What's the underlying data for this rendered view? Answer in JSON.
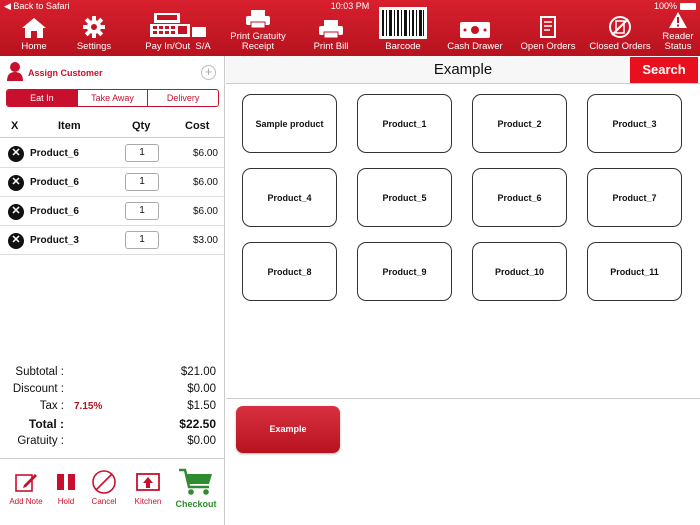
{
  "status": {
    "back": "◀ Back to Safari",
    "time": "10:03 PM",
    "battery": "100%"
  },
  "toolbar": {
    "home": "Home",
    "settings": "Settings",
    "pay": "Pay In/Out",
    "sa": "S/A",
    "print_gratuity_1": "Print Gratuity",
    "print_gratuity_2": "Receipt",
    "print_bill": "Print Bill",
    "barcode": "Barcode",
    "cash_drawer": "Cash Drawer",
    "open_orders": "Open Orders",
    "closed_orders": "Closed Orders",
    "reader_1": "Reader",
    "reader_2": "Status"
  },
  "customer": {
    "assign": "Assign Customer",
    "plus": "+"
  },
  "order_type": {
    "tabs": [
      "Eat In",
      "Take Away",
      "Delivery"
    ],
    "active": 0
  },
  "order": {
    "headers": {
      "x": "X",
      "item": "Item",
      "qty": "Qty",
      "cost": "Cost"
    },
    "items": [
      {
        "name": "Product_6",
        "qty": "1",
        "cost": "$6.00"
      },
      {
        "name": "Product_6",
        "qty": "1",
        "cost": "$6.00"
      },
      {
        "name": "Product_6",
        "qty": "1",
        "cost": "$6.00"
      },
      {
        "name": "Product_3",
        "qty": "1",
        "cost": "$3.00"
      }
    ]
  },
  "totals": {
    "subtotal_label": "Subtotal :",
    "subtotal": "$21.00",
    "discount_label": "Discount :",
    "discount": "$0.00",
    "tax_label": "Tax :",
    "tax_rate": "7.15%",
    "tax": "$1.50",
    "total_label": "Total :",
    "total": "$22.50",
    "gratuity_label": "Gratuity :",
    "gratuity": "$0.00"
  },
  "actions": {
    "add_note": "Add Note",
    "hold": "Hold",
    "cancel": "Cancel",
    "kitchen": "Kitchen",
    "checkout": "Checkout"
  },
  "category": {
    "title": "Example",
    "search": "Search",
    "button": "Example"
  },
  "products": [
    "Sample product",
    "Product_1",
    "Product_2",
    "Product_3",
    "Product_4",
    "Product_5",
    "Product_6",
    "Product_7",
    "Product_8",
    "Product_9",
    "Product_10",
    "Product_11"
  ],
  "colors": {
    "brand_red": "#c8102e",
    "search_red": "#e8101e",
    "checkout_green": "#2e8b2e"
  }
}
